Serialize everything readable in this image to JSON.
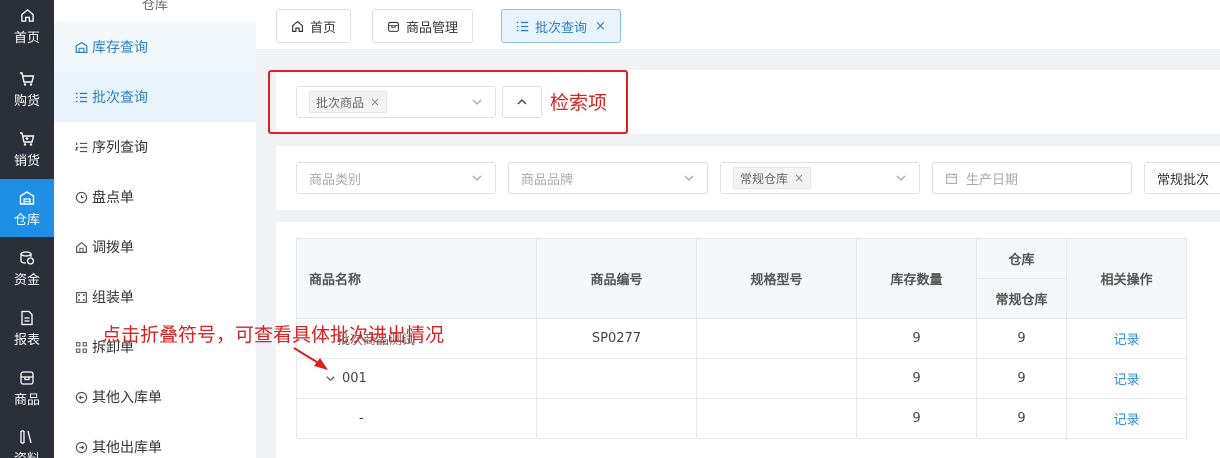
{
  "rail": {
    "items": [
      {
        "label": "首页",
        "icon": "home-icon"
      },
      {
        "label": "购货",
        "icon": "cart-icon"
      },
      {
        "label": "销货",
        "icon": "sell-cart-icon"
      },
      {
        "label": "仓库",
        "icon": "warehouse-icon"
      },
      {
        "label": "资金",
        "icon": "coins-icon"
      },
      {
        "label": "报表",
        "icon": "report-icon"
      },
      {
        "label": "商品",
        "icon": "box-icon"
      },
      {
        "label": "资料",
        "icon": "books-icon"
      }
    ]
  },
  "sidebar": {
    "title": "仓库",
    "items": [
      {
        "label": "库存查询"
      },
      {
        "label": "批次查询"
      },
      {
        "label": "序列查询"
      },
      {
        "label": "盘点单"
      },
      {
        "label": "调拨单"
      },
      {
        "label": "组装单"
      },
      {
        "label": "拆卸单"
      },
      {
        "label": "其他入库单"
      },
      {
        "label": "其他出库单"
      }
    ]
  },
  "tabs": [
    {
      "label": "首页"
    },
    {
      "label": "商品管理"
    },
    {
      "label": "批次查询",
      "close": "×"
    }
  ],
  "search": {
    "field_chip": "批次商品",
    "chip_close": "×",
    "annotation": "检索项"
  },
  "filters": {
    "category_placeholder": "商品类别",
    "brand_placeholder": "商品品牌",
    "warehouse_chip": "常规仓库",
    "date_placeholder": "生产日期",
    "batch_type": "常规批次"
  },
  "table": {
    "headers": {
      "name": "商品名称",
      "code": "商品编号",
      "spec": "规格型号",
      "qty": "库存数量",
      "warehouse": "仓库",
      "warehouse_sub": "常规仓库",
      "ops": "相关操作"
    },
    "rows": [
      {
        "name": "批次商品测试",
        "code": "SP0277",
        "spec": "",
        "qty": "9",
        "wh": "9",
        "op": "记录"
      },
      {
        "name": "001",
        "code": "",
        "spec": "",
        "qty": "9",
        "wh": "9",
        "op": "记录"
      },
      {
        "name": "-",
        "code": "",
        "spec": "",
        "qty": "9",
        "wh": "9",
        "op": "记录"
      }
    ]
  },
  "annotation": "点击折叠符号，可查看具体批次进出情况",
  "colors": {
    "accent": "#1f8fe5",
    "annotation_red": "#e02020",
    "rail_bg": "#2b2f3a"
  }
}
